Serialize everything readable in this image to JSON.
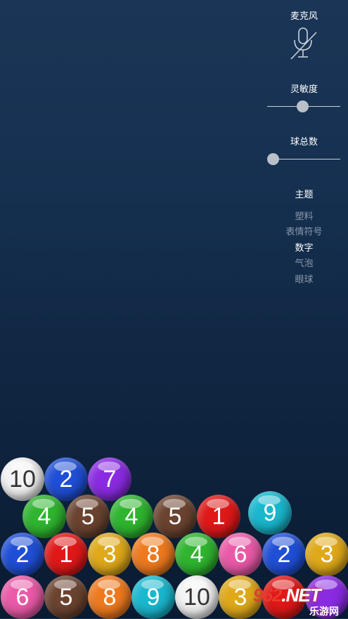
{
  "panel": {
    "mic_label": "麦克风",
    "mic_icon": "microphone-off-icon",
    "sensitivity_label": "灵敏度",
    "sensitivity_value": 0.48,
    "ball_count_label": "球总数",
    "ball_count_value": 0.0,
    "theme_label": "主题",
    "themes": [
      {
        "label": "塑料",
        "active": false
      },
      {
        "label": "表情符号",
        "active": false
      },
      {
        "label": "数字",
        "active": true
      },
      {
        "label": "气泡",
        "active": false
      },
      {
        "label": "眼球",
        "active": false
      }
    ]
  },
  "balls": [
    {
      "n": "10",
      "color": "#f4f4f4"
    },
    {
      "n": "2",
      "color": "#1f4fd6"
    },
    {
      "n": "7",
      "color": "#8a2be2"
    },
    {
      "n": "4",
      "color": "#2fb52f"
    },
    {
      "n": "5",
      "color": "#6b4330"
    },
    {
      "n": "4",
      "color": "#2fb52f"
    },
    {
      "n": "5",
      "color": "#6b4330"
    },
    {
      "n": "1",
      "color": "#e01818"
    },
    {
      "n": "9",
      "color": "#19b8cf"
    },
    {
      "n": "2",
      "color": "#1f4fd6"
    },
    {
      "n": "1",
      "color": "#e01818"
    },
    {
      "n": "3",
      "color": "#e0a91a"
    },
    {
      "n": "8",
      "color": "#ef7a1e"
    },
    {
      "n": "4",
      "color": "#2fb52f"
    },
    {
      "n": "6",
      "color": "#ea5aa8"
    },
    {
      "n": "2",
      "color": "#1f4fd6"
    },
    {
      "n": "3",
      "color": "#e0a91a"
    },
    {
      "n": "6",
      "color": "#ea5aa8"
    },
    {
      "n": "5",
      "color": "#6b4330"
    },
    {
      "n": "8",
      "color": "#ef7a1e"
    },
    {
      "n": "9",
      "color": "#19b8cf"
    },
    {
      "n": "10",
      "color": "#f4f4f4"
    },
    {
      "n": "3",
      "color": "#e0a91a"
    },
    {
      "n": "",
      "color": "#e01818"
    },
    {
      "n": "",
      "color": "#8a2be2"
    }
  ],
  "watermark": {
    "logo_num": "962",
    "logo_net": ".NET",
    "sub": "乐游网"
  }
}
